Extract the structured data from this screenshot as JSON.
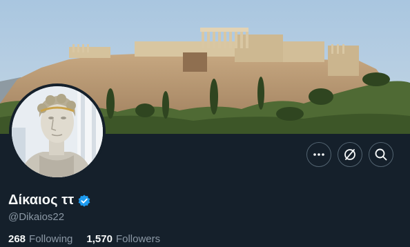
{
  "profile": {
    "display_name": "Δίκαιος ττ",
    "handle": "@Dikaios22",
    "verified": true,
    "following_count": "268",
    "following_label": "Following",
    "followers_count": "1,570",
    "followers_label": "Followers"
  },
  "header": {
    "banner_image": "acropolis-banner",
    "avatar_image": "greek-statue-avatar"
  },
  "actions": {
    "more_icon": "more-horizontal-icon",
    "follow_icon": "unfollow-circle-icon",
    "search_icon": "search-icon"
  },
  "colors": {
    "background": "#15202b",
    "text_primary": "#f7f9f9",
    "text_secondary": "#8b98a5",
    "verified": "#1d9bf0",
    "button_border": "#536471"
  }
}
